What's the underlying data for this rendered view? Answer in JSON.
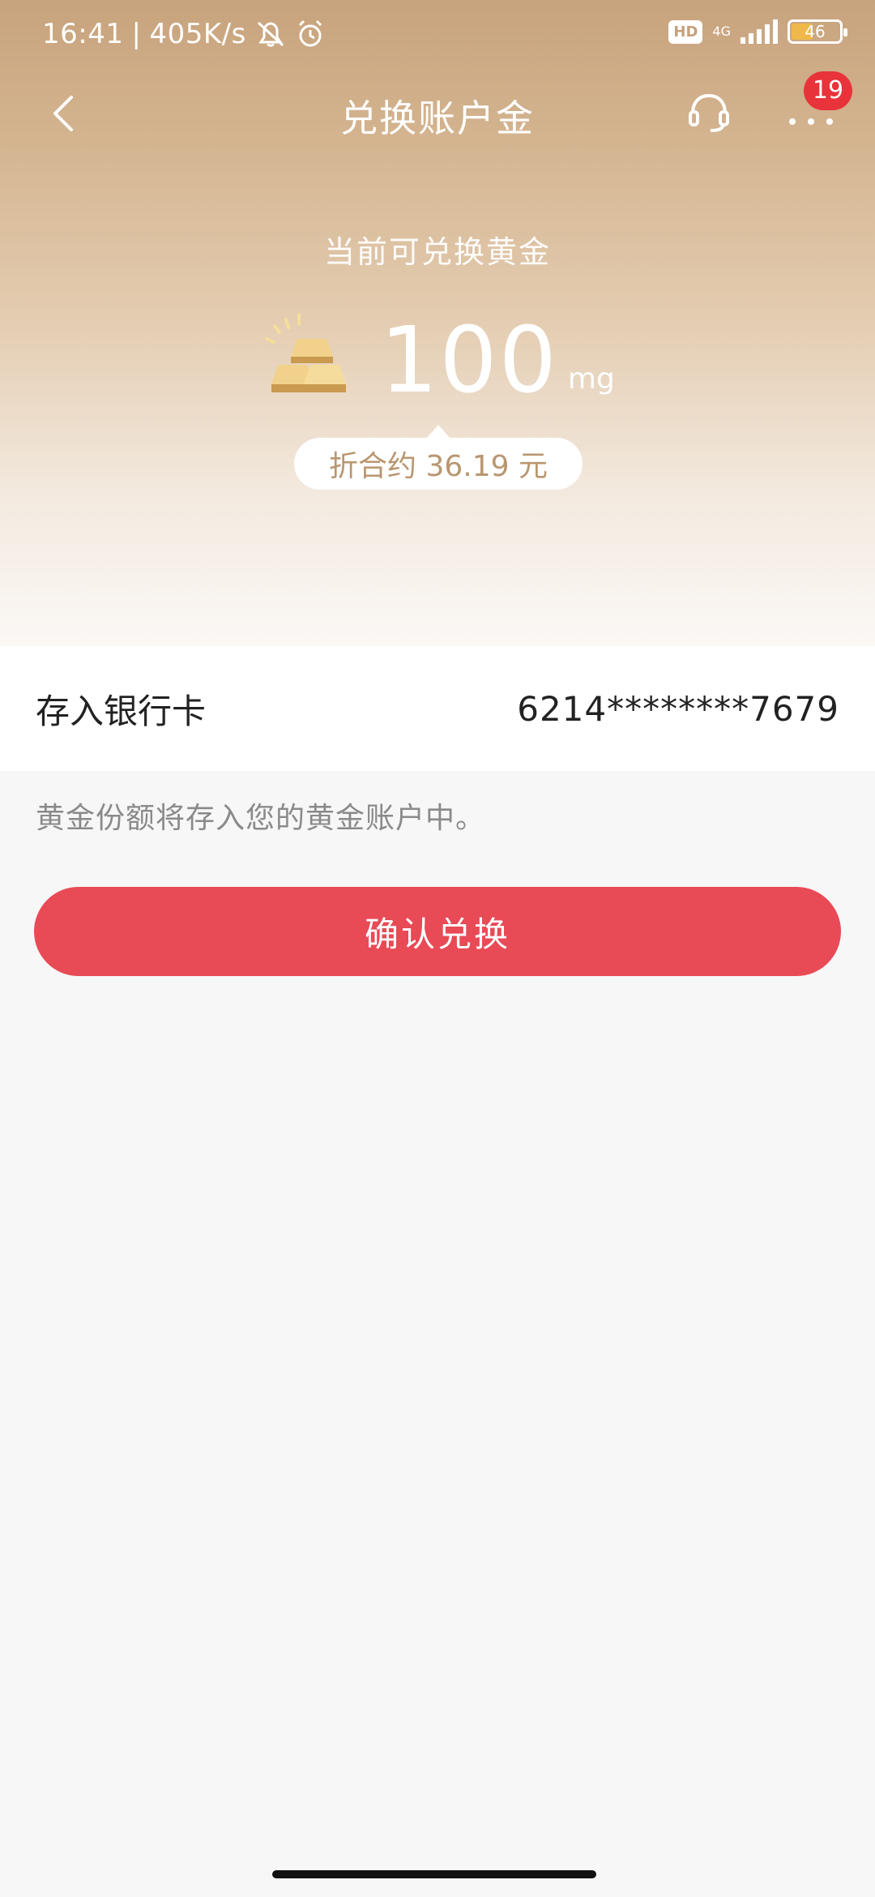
{
  "status_bar": {
    "time": "16:41",
    "separator": "|",
    "speed": "405K/s",
    "hd": "HD",
    "network": "4G",
    "battery": "46",
    "battery_level": 0.46
  },
  "nav": {
    "title": "兑换账户金",
    "badge_count": "19"
  },
  "hero": {
    "label": "当前可兑换黄金",
    "amount": "100",
    "unit": "mg",
    "equivalent": "折合约 36.19 元"
  },
  "card": {
    "label": "存入银行卡",
    "number": "6214********7679"
  },
  "note": "黄金份额将存入您的黄金账户中。",
  "confirm_button": "确认兑换",
  "colors": {
    "accent": "#e84a56",
    "gold": "#c7a37d",
    "badge": "#e8333a"
  }
}
